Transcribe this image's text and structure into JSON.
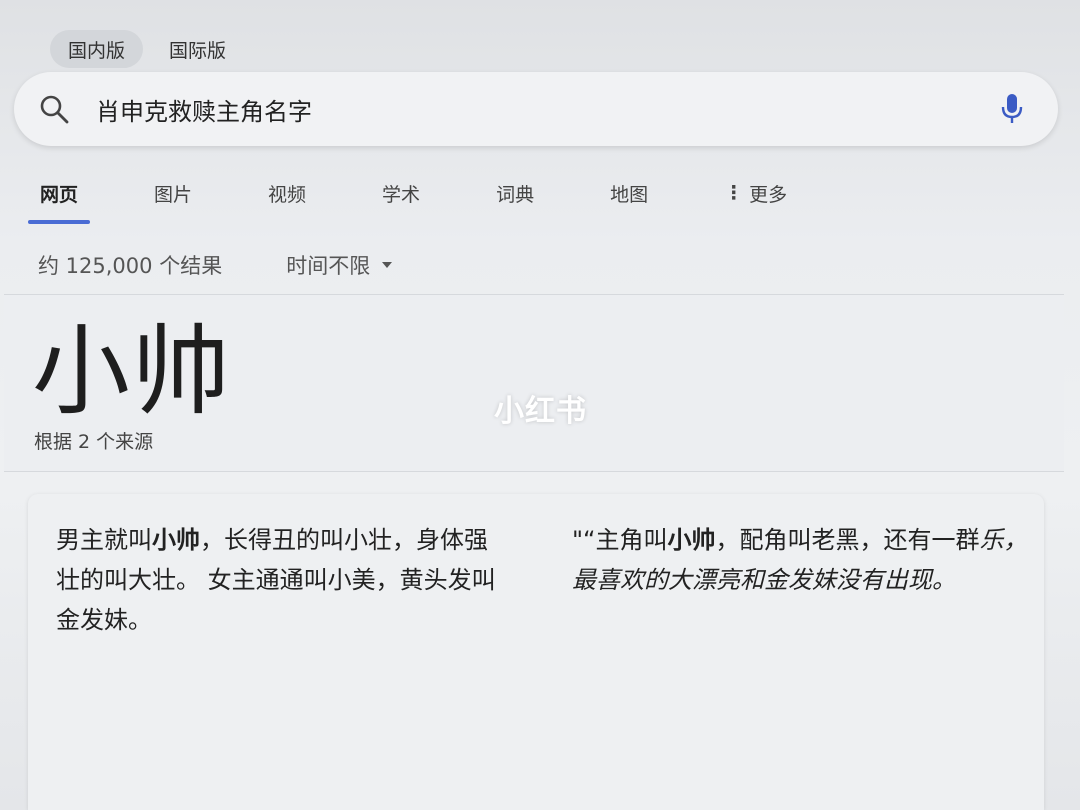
{
  "region_toggle": {
    "domestic": "国内版",
    "international": "国际版"
  },
  "search": {
    "query": "肖申克救赎主角名字"
  },
  "tabs": [
    {
      "label": "网页"
    },
    {
      "label": "图片"
    },
    {
      "label": "视频"
    },
    {
      "label": "学术"
    },
    {
      "label": "词典"
    },
    {
      "label": "地图"
    },
    {
      "label": "更多"
    }
  ],
  "stats": {
    "count_text": "约 125,000 个结果",
    "time_filter": "时间不限"
  },
  "answer": {
    "title": "小帅",
    "sources": "根据 2 个来源"
  },
  "watermark": "小红书",
  "snippets": {
    "left": {
      "part1": "男主就叫",
      "bold": "小帅",
      "part2": "，长得丑的叫小壮，身体强壮的叫大壮。 女主通通叫小美，黄头发叫金发妹。"
    },
    "right": {
      "part1": "\"“主角叫",
      "bold": "小帅",
      "part2": "，配角叫老黑，还有一群",
      "part3": "乐，最喜欢的大漂亮和金发妹没有出现。"
    }
  },
  "colors": {
    "accent": "#4a6cd4",
    "mic": "#3b5bc4"
  }
}
